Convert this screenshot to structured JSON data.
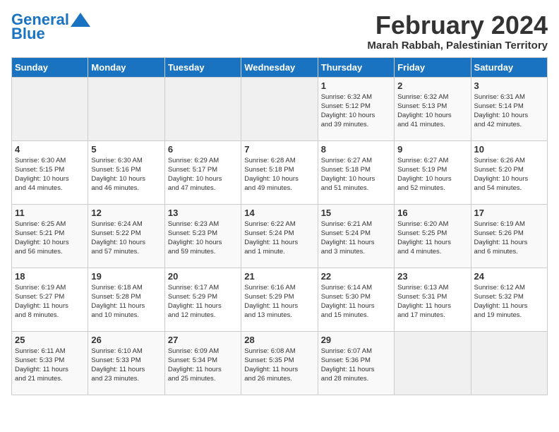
{
  "logo": {
    "line1": "General",
    "line2": "Blue"
  },
  "title": "February 2024",
  "location": "Marah Rabbah, Palestinian Territory",
  "days_header": [
    "Sunday",
    "Monday",
    "Tuesday",
    "Wednesday",
    "Thursday",
    "Friday",
    "Saturday"
  ],
  "weeks": [
    [
      {
        "day": "",
        "info": ""
      },
      {
        "day": "",
        "info": ""
      },
      {
        "day": "",
        "info": ""
      },
      {
        "day": "",
        "info": ""
      },
      {
        "day": "1",
        "info": "Sunrise: 6:32 AM\nSunset: 5:12 PM\nDaylight: 10 hours\nand 39 minutes."
      },
      {
        "day": "2",
        "info": "Sunrise: 6:32 AM\nSunset: 5:13 PM\nDaylight: 10 hours\nand 41 minutes."
      },
      {
        "day": "3",
        "info": "Sunrise: 6:31 AM\nSunset: 5:14 PM\nDaylight: 10 hours\nand 42 minutes."
      }
    ],
    [
      {
        "day": "4",
        "info": "Sunrise: 6:30 AM\nSunset: 5:15 PM\nDaylight: 10 hours\nand 44 minutes."
      },
      {
        "day": "5",
        "info": "Sunrise: 6:30 AM\nSunset: 5:16 PM\nDaylight: 10 hours\nand 46 minutes."
      },
      {
        "day": "6",
        "info": "Sunrise: 6:29 AM\nSunset: 5:17 PM\nDaylight: 10 hours\nand 47 minutes."
      },
      {
        "day": "7",
        "info": "Sunrise: 6:28 AM\nSunset: 5:18 PM\nDaylight: 10 hours\nand 49 minutes."
      },
      {
        "day": "8",
        "info": "Sunrise: 6:27 AM\nSunset: 5:18 PM\nDaylight: 10 hours\nand 51 minutes."
      },
      {
        "day": "9",
        "info": "Sunrise: 6:27 AM\nSunset: 5:19 PM\nDaylight: 10 hours\nand 52 minutes."
      },
      {
        "day": "10",
        "info": "Sunrise: 6:26 AM\nSunset: 5:20 PM\nDaylight: 10 hours\nand 54 minutes."
      }
    ],
    [
      {
        "day": "11",
        "info": "Sunrise: 6:25 AM\nSunset: 5:21 PM\nDaylight: 10 hours\nand 56 minutes."
      },
      {
        "day": "12",
        "info": "Sunrise: 6:24 AM\nSunset: 5:22 PM\nDaylight: 10 hours\nand 57 minutes."
      },
      {
        "day": "13",
        "info": "Sunrise: 6:23 AM\nSunset: 5:23 PM\nDaylight: 10 hours\nand 59 minutes."
      },
      {
        "day": "14",
        "info": "Sunrise: 6:22 AM\nSunset: 5:24 PM\nDaylight: 11 hours\nand 1 minute."
      },
      {
        "day": "15",
        "info": "Sunrise: 6:21 AM\nSunset: 5:24 PM\nDaylight: 11 hours\nand 3 minutes."
      },
      {
        "day": "16",
        "info": "Sunrise: 6:20 AM\nSunset: 5:25 PM\nDaylight: 11 hours\nand 4 minutes."
      },
      {
        "day": "17",
        "info": "Sunrise: 6:19 AM\nSunset: 5:26 PM\nDaylight: 11 hours\nand 6 minutes."
      }
    ],
    [
      {
        "day": "18",
        "info": "Sunrise: 6:19 AM\nSunset: 5:27 PM\nDaylight: 11 hours\nand 8 minutes."
      },
      {
        "day": "19",
        "info": "Sunrise: 6:18 AM\nSunset: 5:28 PM\nDaylight: 11 hours\nand 10 minutes."
      },
      {
        "day": "20",
        "info": "Sunrise: 6:17 AM\nSunset: 5:29 PM\nDaylight: 11 hours\nand 12 minutes."
      },
      {
        "day": "21",
        "info": "Sunrise: 6:16 AM\nSunset: 5:29 PM\nDaylight: 11 hours\nand 13 minutes."
      },
      {
        "day": "22",
        "info": "Sunrise: 6:14 AM\nSunset: 5:30 PM\nDaylight: 11 hours\nand 15 minutes."
      },
      {
        "day": "23",
        "info": "Sunrise: 6:13 AM\nSunset: 5:31 PM\nDaylight: 11 hours\nand 17 minutes."
      },
      {
        "day": "24",
        "info": "Sunrise: 6:12 AM\nSunset: 5:32 PM\nDaylight: 11 hours\nand 19 minutes."
      }
    ],
    [
      {
        "day": "25",
        "info": "Sunrise: 6:11 AM\nSunset: 5:33 PM\nDaylight: 11 hours\nand 21 minutes."
      },
      {
        "day": "26",
        "info": "Sunrise: 6:10 AM\nSunset: 5:33 PM\nDaylight: 11 hours\nand 23 minutes."
      },
      {
        "day": "27",
        "info": "Sunrise: 6:09 AM\nSunset: 5:34 PM\nDaylight: 11 hours\nand 25 minutes."
      },
      {
        "day": "28",
        "info": "Sunrise: 6:08 AM\nSunset: 5:35 PM\nDaylight: 11 hours\nand 26 minutes."
      },
      {
        "day": "29",
        "info": "Sunrise: 6:07 AM\nSunset: 5:36 PM\nDaylight: 11 hours\nand 28 minutes."
      },
      {
        "day": "",
        "info": ""
      },
      {
        "day": "",
        "info": ""
      }
    ]
  ]
}
